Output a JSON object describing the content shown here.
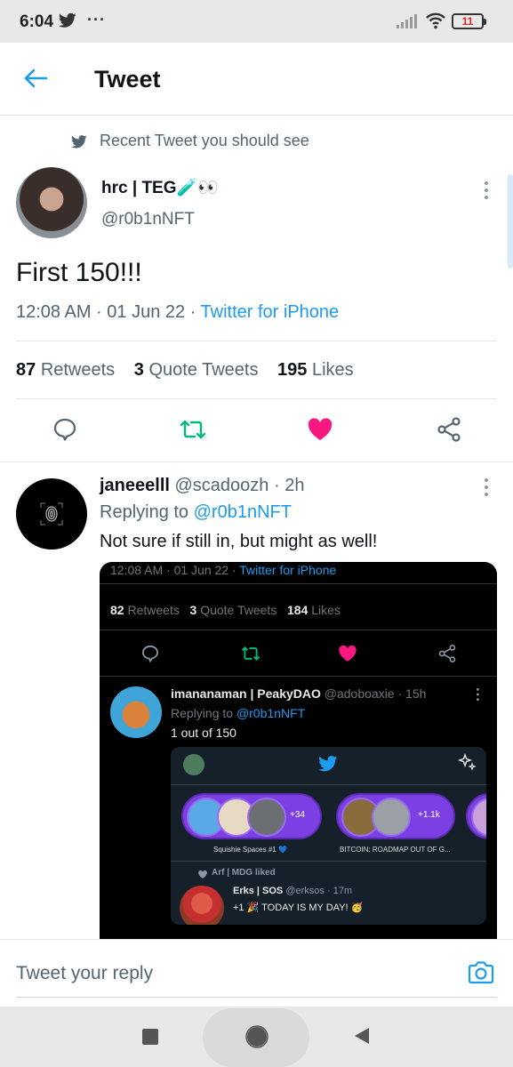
{
  "status_bar": {
    "time": "6:04",
    "dots": "···",
    "battery": "11"
  },
  "header": {
    "title": "Tweet"
  },
  "recent_label": "Recent Tweet you should see",
  "tweet": {
    "author_name": "hrc | TEG🧪👀",
    "author_handle": "@r0b1nNFT",
    "text": "First 150!!!",
    "time": "12:08 AM · 01 Jun 22 · ",
    "source": "Twitter for iPhone",
    "retweets_count": "87",
    "retweets_label": "Retweets",
    "quotes_count": "3",
    "quotes_label": "Quote Tweets",
    "likes_count": "195",
    "likes_label": "Likes"
  },
  "reply": {
    "name": "janeeelll",
    "handle": "@scadoozh",
    "age": " · 2h",
    "replying_prefix": "Replying to ",
    "replying_mention": "@r0b1nNFT",
    "text": "Not sure if still in, but might as well!"
  },
  "screenshot": {
    "time": "12:08 AM · 01 Jun 22 · ",
    "source": "Twitter for iPhone",
    "retweets_count": "82",
    "retweets_label": "Retweets",
    "quotes_count": "3",
    "quotes_label": "Quote Tweets",
    "likes_count": "184",
    "likes_label": "Likes",
    "reply_name": "imananaman | PeakyDAO",
    "reply_handle": "@adoboaxie",
    "reply_age": " · 15h",
    "replying_prefix": "Replying to ",
    "replying_mention": "@r0b1nNFT",
    "reply_text": "1 out of 150",
    "inner": {
      "space1_count": "+34",
      "space1_label": "Squishie Spaces #1 💙",
      "space2_count": "+1.1k",
      "space2_label": "BITCOIN: ROADMAP OUT OF G...",
      "liked_label": "Arf | MDG liked",
      "erks_name": "Erks | SOS",
      "erks_handle": "@erksos",
      "erks_age": " · 17m",
      "erks_text": "+1 🎉 TODAY IS MY DAY! 🥳"
    }
  },
  "compose": {
    "placeholder": "Tweet your reply"
  },
  "colors": {
    "accent": "#1d9bf0",
    "retweet": "#00ba7c",
    "like": "#f91880"
  }
}
